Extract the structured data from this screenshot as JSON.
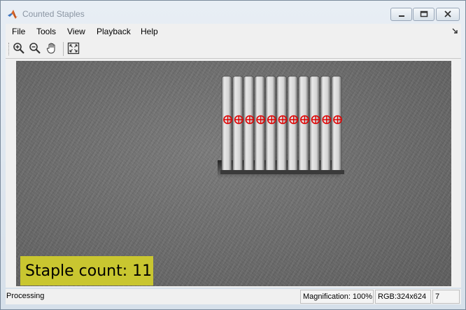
{
  "window": {
    "title": "Counted Staples",
    "icon": "matlab-icon",
    "controls": [
      "minimize-icon",
      "maximize-icon",
      "close-icon"
    ]
  },
  "menu": {
    "items": [
      "File",
      "Tools",
      "View",
      "Playback",
      "Help"
    ],
    "dock_icon": "dock-arrow-icon"
  },
  "toolbar": {
    "buttons": [
      "zoom-in-icon",
      "zoom-out-icon",
      "pan-hand-icon",
      "fit-to-window-icon"
    ]
  },
  "image": {
    "staple_count": 11,
    "marker_color": "#e00000",
    "overlay_text": "Staple count: 11",
    "overlay_color": "#c9c630"
  },
  "status": {
    "text": "Processing",
    "magnification": "Magnification: 100%",
    "pixel_info": "RGB:324x624",
    "frame": "7"
  }
}
